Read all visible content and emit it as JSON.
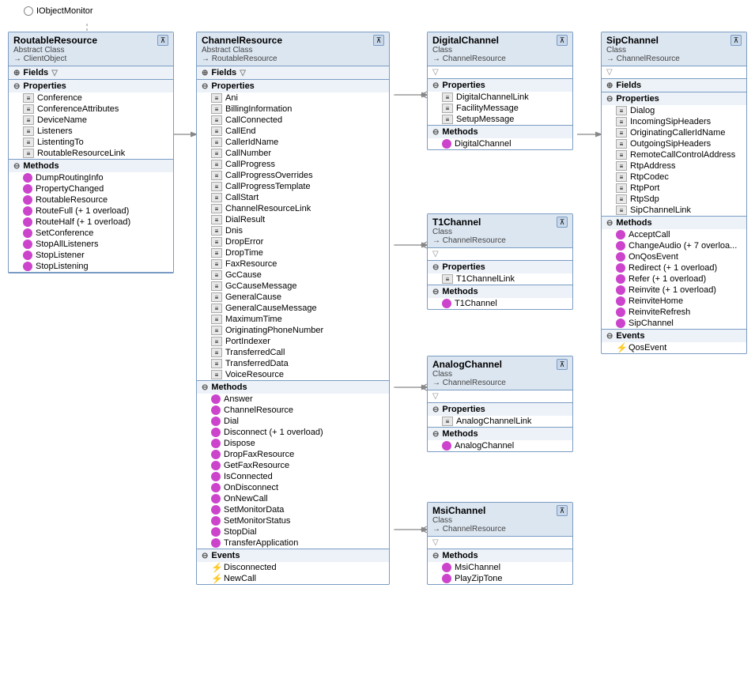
{
  "title": "IObjectMonitor",
  "boxes": {
    "routableResource": {
      "name": "RoutableResource",
      "type": "Abstract Class",
      "parent": "ClientObject",
      "sections": {
        "fields": {
          "label": "Fields",
          "items": []
        },
        "properties": {
          "label": "Properties",
          "items": [
            "Conference",
            "ConferenceAttributes",
            "DeviceName",
            "Listeners",
            "ListentingTo",
            "RoutableResourceLink"
          ]
        },
        "methods": {
          "label": "Methods",
          "items": [
            "DumpRoutingInfo",
            "PropertyChanged",
            "RoutableResource",
            "RouteFull (+ 1 overload)",
            "RouteHalf (+ 1 overload)",
            "SetConference",
            "StopAllListeners",
            "StopListener",
            "StopListening"
          ]
        }
      }
    },
    "channelResource": {
      "name": "ChannelResource",
      "type": "Abstract Class",
      "parent": "RoutableResource",
      "sections": {
        "fields": {
          "label": "Fields",
          "items": []
        },
        "properties": {
          "label": "Properties",
          "items": [
            "Ani",
            "BillingInformation",
            "CallConnected",
            "CallEnd",
            "CallerIdName",
            "CallNumber",
            "CallProgress",
            "CallProgressOverrides",
            "CallProgressTemplate",
            "CallStart",
            "ChannelResourceLink",
            "DialResult",
            "Dnis",
            "DropError",
            "DropTime",
            "FaxResource",
            "GcCause",
            "GcCauseMessage",
            "GeneralCause",
            "GeneralCauseMessage",
            "MaximumTime",
            "OriginatingPhoneNumber",
            "PortIndexer",
            "TransferredCall",
            "TransferredData",
            "VoiceResource"
          ]
        },
        "methods": {
          "label": "Methods",
          "items": [
            "Answer",
            "ChannelResource",
            "Dial",
            "Disconnect (+ 1 overload)",
            "Dispose",
            "DropFaxResource",
            "GetFaxResource",
            "IsConnected",
            "OnDisconnect",
            "OnNewCall",
            "SetMonitorData",
            "SetMonitorStatus",
            "StopDial",
            "TransferApplication"
          ]
        },
        "events": {
          "label": "Events",
          "items": [
            "Disconnected",
            "NewCall"
          ]
        }
      }
    },
    "digitalChannel": {
      "name": "DigitalChannel",
      "type": "Class",
      "parent": "ChannelResource",
      "sections": {
        "properties": {
          "label": "Properties",
          "items": [
            "DigitalChannelLink",
            "FacilityMessage",
            "SetupMessage"
          ]
        },
        "methods": {
          "label": "Methods",
          "items": [
            "DigitalChannel"
          ]
        }
      }
    },
    "sipChannel": {
      "name": "SipChannel",
      "type": "Class",
      "parent": "ChannelResource",
      "sections": {
        "fields": {
          "label": "Fields",
          "items": []
        },
        "properties": {
          "label": "Properties",
          "items": [
            "Dialog",
            "IncomingSipHeaders",
            "OriginatingCallerIdName",
            "OutgoingSipHeaders",
            "RemoteCallControlAddress",
            "RtpAddress",
            "RtpCodec",
            "RtpPort",
            "RtpSdp",
            "SipChannelLink"
          ]
        },
        "methods": {
          "label": "Methods",
          "items": [
            "AcceptCall",
            "ChangeAudio (+ 7 overloa...",
            "OnQosEvent",
            "Redirect (+ 1 overload)",
            "Refer (+ 1 overload)",
            "Reinvite (+ 1 overload)",
            "ReinviteHome",
            "ReinviteRefresh",
            "SipChannel"
          ]
        },
        "events": {
          "label": "Events",
          "items": [
            "QosEvent"
          ]
        }
      }
    },
    "t1Channel": {
      "name": "T1Channel",
      "type": "Class",
      "parent": "ChannelResource",
      "sections": {
        "properties": {
          "label": "Properties",
          "items": [
            "T1ChannelLink"
          ]
        },
        "methods": {
          "label": "Methods",
          "items": [
            "T1Channel"
          ]
        }
      }
    },
    "analogChannel": {
      "name": "AnalogChannel",
      "type": "Class",
      "parent": "ChannelResource",
      "sections": {
        "properties": {
          "label": "Properties",
          "items": [
            "AnalogChannelLink"
          ]
        },
        "methods": {
          "label": "Methods",
          "items": [
            "AnalogChannel"
          ]
        }
      }
    },
    "msiChannel": {
      "name": "MsiChannel",
      "type": "Class",
      "parent": "ChannelResource",
      "sections": {
        "methods": {
          "label": "Methods",
          "items": [
            "MsiChannel",
            "PlayZipTone"
          ]
        }
      }
    }
  },
  "labels": {
    "abstract_class": "Abstract Class",
    "class": "Class",
    "fields_label": "Fields",
    "properties_label": "Properties",
    "methods_label": "Methods",
    "events_label": "Events"
  }
}
